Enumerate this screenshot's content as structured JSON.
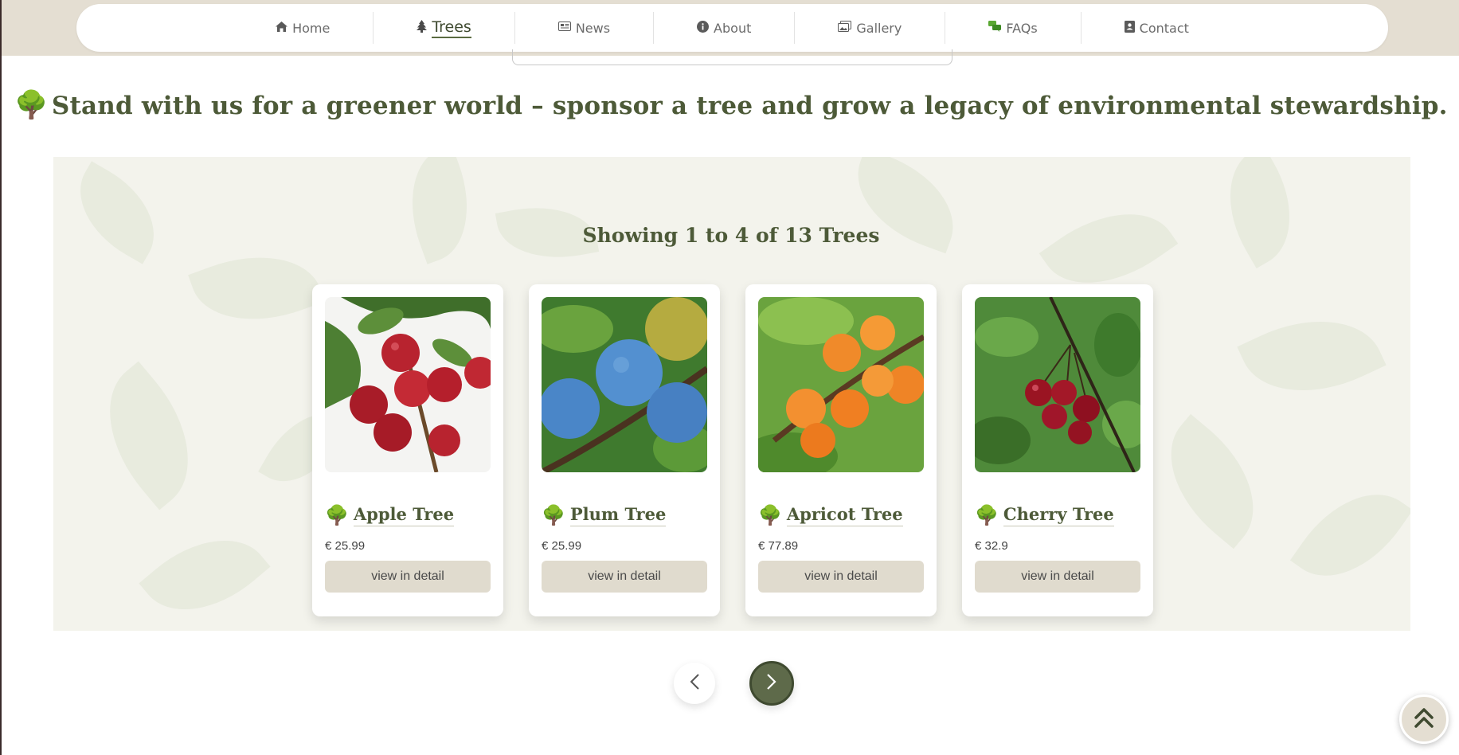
{
  "nav": {
    "items": [
      {
        "label": "Home",
        "icon": "home-icon",
        "active": false
      },
      {
        "label": "Trees",
        "icon": "tree-icon",
        "active": true
      },
      {
        "label": "News",
        "icon": "newspaper-icon",
        "active": false
      },
      {
        "label": "About",
        "icon": "info-icon",
        "active": false
      },
      {
        "label": "Gallery",
        "icon": "images-icon",
        "active": false
      },
      {
        "label": "FAQs",
        "icon": "comments-icon",
        "active": false
      },
      {
        "label": "Contact",
        "icon": "address-book-icon",
        "active": false
      }
    ]
  },
  "headline": "Stand with us for a greener world – sponsor a tree and grow a legacy of environmental stewardship.",
  "listing": {
    "showing": "Showing 1 to 4 of 13 Trees",
    "cards": [
      {
        "name": "Apple Tree",
        "price": "€ 25.99",
        "button": "view in detail",
        "fruit_color": "#b8232f"
      },
      {
        "name": "Plum Tree",
        "price": "€ 25.99",
        "button": "view in detail",
        "fruit_color": "#4a86c8"
      },
      {
        "name": "Apricot Tree",
        "price": "€ 77.89",
        "button": "view in detail",
        "fruit_color": "#f08a2a"
      },
      {
        "name": "Cherry Tree",
        "price": "€ 32.9",
        "button": "view in detail",
        "fruit_color": "#9a1422"
      }
    ]
  },
  "colors": {
    "accent": "#4d5a38",
    "nav_band": "#e4ded2",
    "button_bg": "#e0dbce",
    "pager_active": "#5e6a4a"
  }
}
